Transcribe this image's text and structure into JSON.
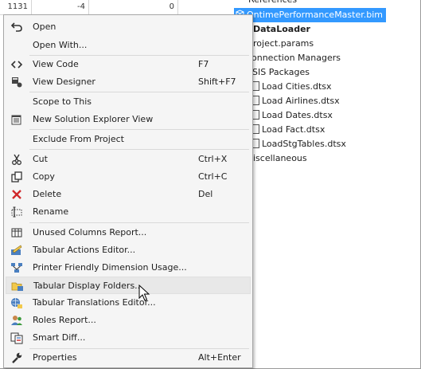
{
  "grid": {
    "row": [
      "1131",
      "-4",
      "0"
    ]
  },
  "tree": {
    "items": [
      {
        "label": "References",
        "style": "normal"
      },
      {
        "label": "OntimePerformanceMaster.bim",
        "style": "selected"
      },
      {
        "label": "DataLoader",
        "style": "bold"
      },
      {
        "label": "roject.params",
        "style": "normal"
      },
      {
        "label": "onnection Managers",
        "style": "normal"
      },
      {
        "label": "SIS Packages",
        "style": "normal"
      },
      {
        "label": "Load Cities.dtsx",
        "style": "package"
      },
      {
        "label": "Load Airlines.dtsx",
        "style": "package"
      },
      {
        "label": "Load Dates.dtsx",
        "style": "package"
      },
      {
        "label": "Load Fact.dtsx",
        "style": "package"
      },
      {
        "label": "LoadStgTables.dtsx",
        "style": "package"
      },
      {
        "label": "iscellaneous",
        "style": "normal"
      }
    ]
  },
  "menu": {
    "items": [
      {
        "label": "Open",
        "shortcut": "",
        "icon": "undo-arrow-icon"
      },
      {
        "label": "Open With...",
        "shortcut": "",
        "icon": ""
      },
      {
        "label": "View Code",
        "shortcut": "F7",
        "icon": "code-brackets-icon"
      },
      {
        "label": "View Designer",
        "shortcut": "Shift+F7",
        "icon": "designer-icon"
      },
      {
        "label": "Scope to This",
        "shortcut": "",
        "icon": ""
      },
      {
        "label": "New Solution Explorer View",
        "shortcut": "",
        "icon": "solution-explorer-icon"
      },
      {
        "label": "Exclude From Project",
        "shortcut": "",
        "icon": ""
      },
      {
        "label": "Cut",
        "shortcut": "Ctrl+X",
        "icon": "scissors-icon"
      },
      {
        "label": "Copy",
        "shortcut": "Ctrl+C",
        "icon": "copy-icon"
      },
      {
        "label": "Delete",
        "shortcut": "Del",
        "icon": "delete-x-icon"
      },
      {
        "label": "Rename",
        "shortcut": "",
        "icon": "rename-icon"
      },
      {
        "label": "Unused Columns Report...",
        "shortcut": "",
        "icon": "report-columns-icon"
      },
      {
        "label": "Tabular Actions Editor...",
        "shortcut": "",
        "icon": "actions-editor-icon"
      },
      {
        "label": "Printer Friendly Dimension Usage...",
        "shortcut": "",
        "icon": "dimension-usage-icon"
      },
      {
        "label": "Tabular Display Folders...",
        "shortcut": "",
        "icon": "display-folders-icon"
      },
      {
        "label": "Tabular Translations Editor...",
        "shortcut": "",
        "icon": "translations-icon"
      },
      {
        "label": "Roles Report...",
        "shortcut": "",
        "icon": "roles-report-icon"
      },
      {
        "label": "Smart Diff...",
        "shortcut": "",
        "icon": "smart-diff-icon"
      },
      {
        "label": "Properties",
        "shortcut": "Alt+Enter",
        "icon": "wrench-icon"
      }
    ]
  },
  "colors": {
    "selection": "#3399ff",
    "menu_bg": "#f5f5f5",
    "hover": "#e8e8e8",
    "delete_red": "#d0282a"
  }
}
